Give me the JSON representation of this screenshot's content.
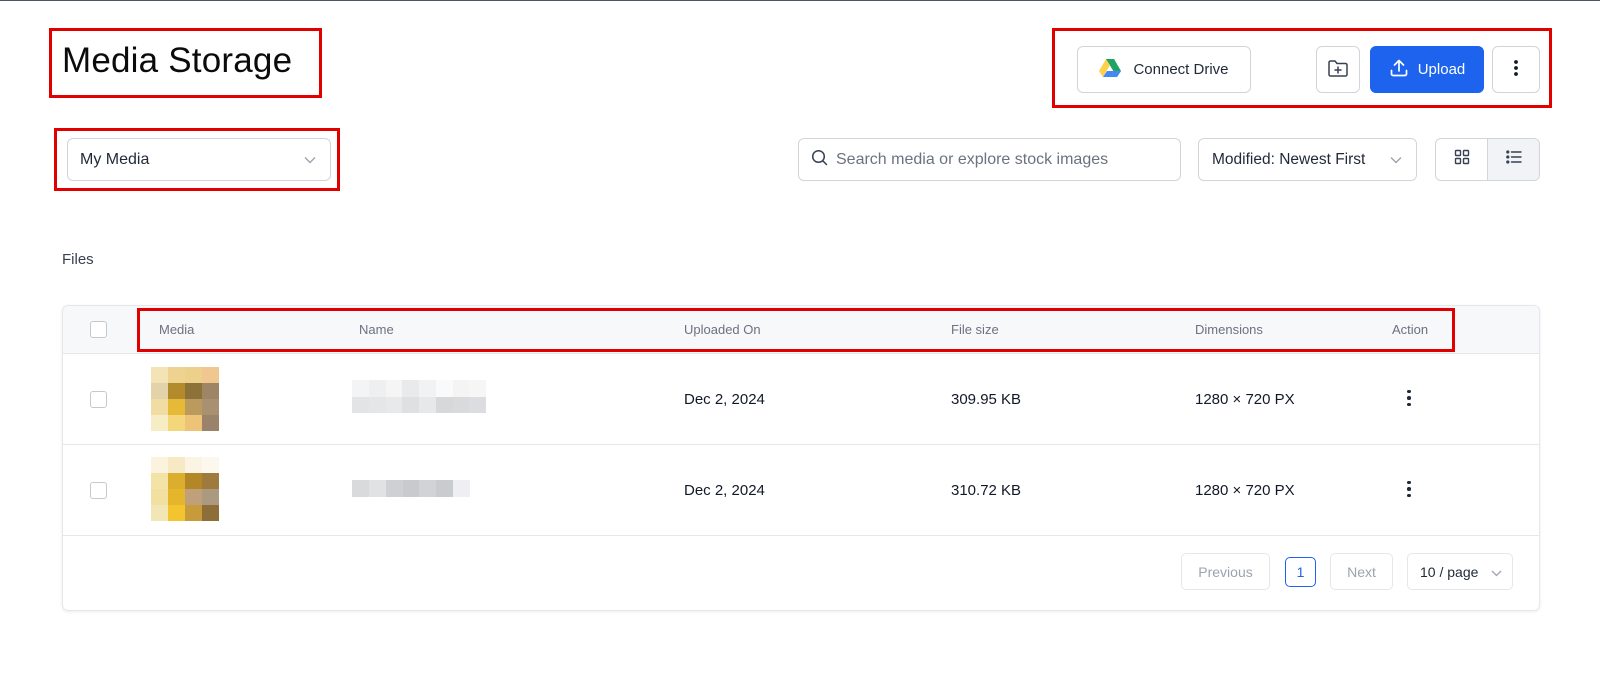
{
  "header": {
    "title": "Media Storage",
    "connect_drive_label": "Connect Drive",
    "upload_label": "Upload"
  },
  "filters": {
    "source_value": "My Media",
    "search_placeholder": "Search media or explore stock images",
    "sort_value": "Modified: Newest First"
  },
  "section_label": "Files",
  "table": {
    "columns": [
      "Media",
      "Name",
      "Uploaded On",
      "File size",
      "Dimensions",
      "Action"
    ],
    "rows": [
      {
        "uploaded_on": "Dec 2, 2024",
        "file_size": "309.95 KB",
        "dimensions": "1280 × 720 PX"
      },
      {
        "uploaded_on": "Dec 2, 2024",
        "file_size": "310.72 KB",
        "dimensions": "1280 × 720 PX"
      }
    ]
  },
  "pagination": {
    "previous_label": "Previous",
    "current_page": "1",
    "next_label": "Next",
    "page_size": "10 / page"
  },
  "colors": {
    "primary": "#1d63ed",
    "highlight": "#e10000"
  }
}
